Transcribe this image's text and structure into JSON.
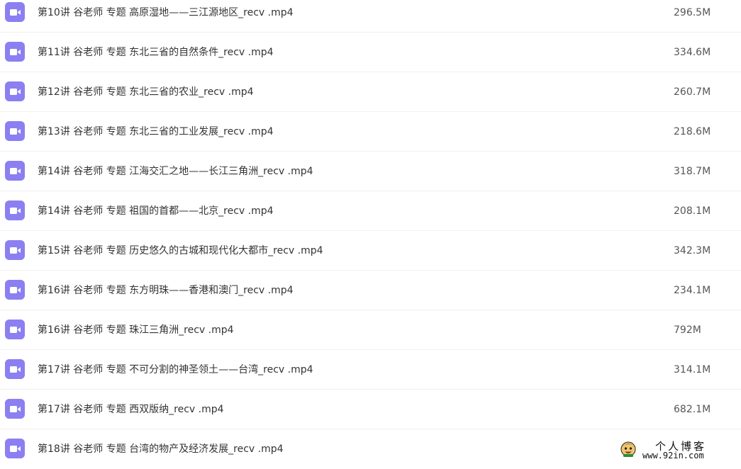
{
  "files": [
    {
      "name": "第10讲 谷老师 专题 高原湿地——三江源地区_recv .mp4",
      "size": "296.5M",
      "icon": "video-file-icon"
    },
    {
      "name": "第11讲 谷老师 专题 东北三省的自然条件_recv .mp4",
      "size": "334.6M",
      "icon": "video-file-icon"
    },
    {
      "name": "第12讲 谷老师 专题 东北三省的农业_recv .mp4",
      "size": "260.7M",
      "icon": "video-file-icon"
    },
    {
      "name": "第13讲 谷老师 专题 东北三省的工业发展_recv .mp4",
      "size": "218.6M",
      "icon": "video-file-icon"
    },
    {
      "name": "第14讲 谷老师 专题 江海交汇之地——长江三角洲_recv .mp4",
      "size": "318.7M",
      "icon": "video-file-icon"
    },
    {
      "name": "第14讲 谷老师 专题 祖国的首都——北京_recv .mp4",
      "size": "208.1M",
      "icon": "video-file-icon"
    },
    {
      "name": "第15讲 谷老师 专题 历史悠久的古城和现代化大都市_recv .mp4",
      "size": "342.3M",
      "icon": "video-file-icon"
    },
    {
      "name": "第16讲 谷老师 专题 东方明珠——香港和澳门_recv .mp4",
      "size": "234.1M",
      "icon": "video-file-icon"
    },
    {
      "name": "第16讲 谷老师 专题 珠江三角洲_recv .mp4",
      "size": "792M",
      "icon": "video-file-icon"
    },
    {
      "name": "第17讲 谷老师 专题 不可分割的神圣领土——台湾_recv .mp4",
      "size": "314.1M",
      "icon": "video-file-icon"
    },
    {
      "name": "第17讲 谷老师 专题 西双版纳_recv .mp4",
      "size": "682.1M",
      "icon": "video-file-icon"
    },
    {
      "name": "第18讲 谷老师 专题 台湾的物产及经济发展_recv .mp4",
      "size": "",
      "icon": "video-file-icon"
    }
  ],
  "watermark": {
    "title": "个人博客",
    "url": "www.92in.com"
  },
  "colors": {
    "icon_bg": "#8b7ff2",
    "icon_fg": "#ffffff",
    "text": "#333333",
    "divider": "#f0f0f0"
  }
}
